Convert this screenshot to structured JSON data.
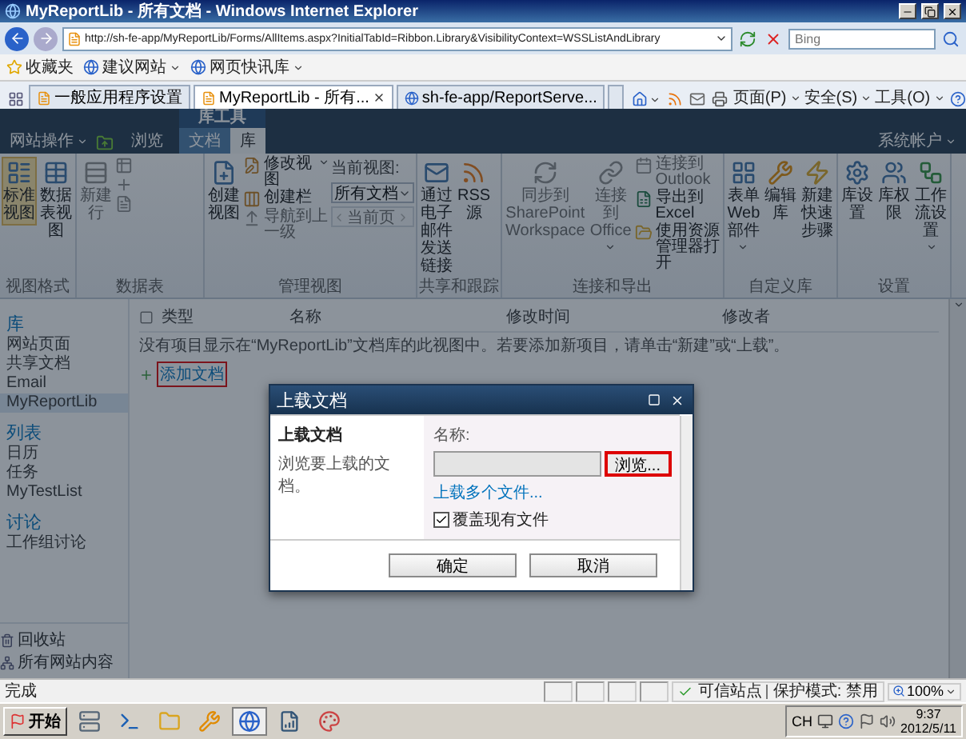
{
  "window": {
    "title": "MyReportLib - 所有文档 - Windows Internet Explorer"
  },
  "address_bar": {
    "url": "http://sh-fe-app/MyReportLib/Forms/AllItems.aspx?InitialTabId=Ribbon.Library&VisibilityContext=WSSListAndLibrary",
    "search_placeholder": "Bing"
  },
  "favorites_bar": {
    "title": "收藏夹",
    "links": [
      "建议网站",
      "网页快讯库"
    ]
  },
  "browser_tabs": [
    {
      "label": "一般应用程序设置",
      "selected": false
    },
    {
      "label": "MyReportLib - 所有...",
      "selected": true
    },
    {
      "label": "sh-fe-app/ReportServe...",
      "selected": false
    }
  ],
  "command_bar": [
    "页面(P)",
    "安全(S)",
    "工具(O)"
  ],
  "sharepoint": {
    "site_actions": "网站操作",
    "context_group": "库工具",
    "user": "系统帐户",
    "tabs": [
      {
        "label": "浏览",
        "selected": false,
        "contextual": false
      },
      {
        "label": "文档",
        "selected": false,
        "contextual": true
      },
      {
        "label": "库",
        "selected": true,
        "contextual": true
      }
    ]
  },
  "ribbon": {
    "groups": [
      {
        "label": "视图格式",
        "items": [
          {
            "kind": "large",
            "label": "标准视图",
            "selected": true,
            "disabled": false
          },
          {
            "kind": "large",
            "label": "数据表视图",
            "selected": false,
            "disabled": false
          }
        ]
      },
      {
        "label": "数据表",
        "items": [
          {
            "kind": "large",
            "label": "新建行",
            "disabled": true
          },
          {
            "kind": "column",
            "items": [
              {
                "disabled": true
              },
              {
                "disabled": true
              },
              {
                "disabled": true
              }
            ]
          }
        ]
      },
      {
        "label": "管理视图",
        "items": [
          {
            "kind": "large",
            "label": "创建视图",
            "disabled": false
          },
          {
            "kind": "column",
            "items": [
              {
                "label": "修改视图",
                "dropdown": true,
                "disabled": false
              },
              {
                "label": "创建栏",
                "disabled": false
              },
              {
                "label": "导航到上一级",
                "disabled": true
              }
            ]
          },
          {
            "kind": "view_select",
            "label": "当前视图:",
            "value": "所有文档",
            "pager": {
              "label": "当前页",
              "disabled": true
            }
          }
        ]
      },
      {
        "label": "共享和跟踪",
        "items": [
          {
            "kind": "large",
            "label": "通过电子邮件发送链接",
            "disabled": false
          },
          {
            "kind": "large",
            "label": "RSS源",
            "disabled": false
          }
        ]
      },
      {
        "label": "连接和导出",
        "items": [
          {
            "kind": "large",
            "label": "同步到 SharePoint Workspace",
            "disabled": true
          },
          {
            "kind": "large",
            "label": "连接到 Office",
            "dropdown": true,
            "disabled": true
          },
          {
            "kind": "column",
            "items": [
              {
                "label": "连接到 Outlook",
                "disabled": true
              },
              {
                "label": "导出到 Excel",
                "disabled": false
              },
              {
                "label": "使用资源管理器打开",
                "disabled": false
              }
            ]
          }
        ]
      },
      {
        "label": "自定义库",
        "items": [
          {
            "kind": "large",
            "label": "表单 Web 部件",
            "dropdown": true,
            "disabled": false
          },
          {
            "kind": "large",
            "label": "编辑库",
            "disabled": false
          },
          {
            "kind": "large",
            "label": "新建快速步骤",
            "disabled": false
          }
        ]
      },
      {
        "label": "设置",
        "items": [
          {
            "kind": "large",
            "label": "库设置",
            "disabled": false
          },
          {
            "kind": "large",
            "label": "库权限",
            "disabled": false
          },
          {
            "kind": "large",
            "label": "工作流设置",
            "dropdown": true,
            "disabled": false
          }
        ]
      }
    ]
  },
  "left_nav": {
    "sections": [
      {
        "heading": "库",
        "items": [
          {
            "label": "网站页面",
            "selected": false
          },
          {
            "label": "共享文档",
            "selected": false
          },
          {
            "label": "Email",
            "selected": false
          },
          {
            "label": "MyReportLib",
            "selected": true
          }
        ]
      },
      {
        "heading": "列表",
        "items": [
          {
            "label": "日历",
            "selected": false
          },
          {
            "label": "任务",
            "selected": false
          },
          {
            "label": "MyTestList",
            "selected": false
          }
        ]
      },
      {
        "heading": "讨论",
        "items": [
          {
            "label": "工作组讨论",
            "selected": false
          }
        ]
      }
    ],
    "footer": [
      "回收站",
      "所有网站内容"
    ]
  },
  "list": {
    "columns": [
      "类型",
      "名称",
      "修改时间",
      "修改者"
    ],
    "empty_message": "没有项目显示在“MyReportLib”文档库的此视图中。若要添加新项目，请单击“新建”或“上载”。",
    "add_link": {
      "label": "添加文档",
      "highlighted": true
    }
  },
  "dialog": {
    "title": "上载文档",
    "heading": "上载文档",
    "description": "浏览要上载的文档。",
    "name_label": "名称:",
    "browse_button": {
      "label": "浏览...",
      "highlighted": true
    },
    "multi_upload_link": "上载多个文件...",
    "overwrite": {
      "label": "覆盖现有文件",
      "checked": true
    },
    "buttons": [
      "确定",
      "取消"
    ]
  },
  "status_bar": {
    "text": "完成",
    "zone": "可信站点",
    "protected_mode": "保护模式: 禁用",
    "zoom": "100%"
  },
  "taskbar": {
    "start": "开始",
    "language": "CH",
    "time": "9:37",
    "date": "2012/5/11"
  }
}
